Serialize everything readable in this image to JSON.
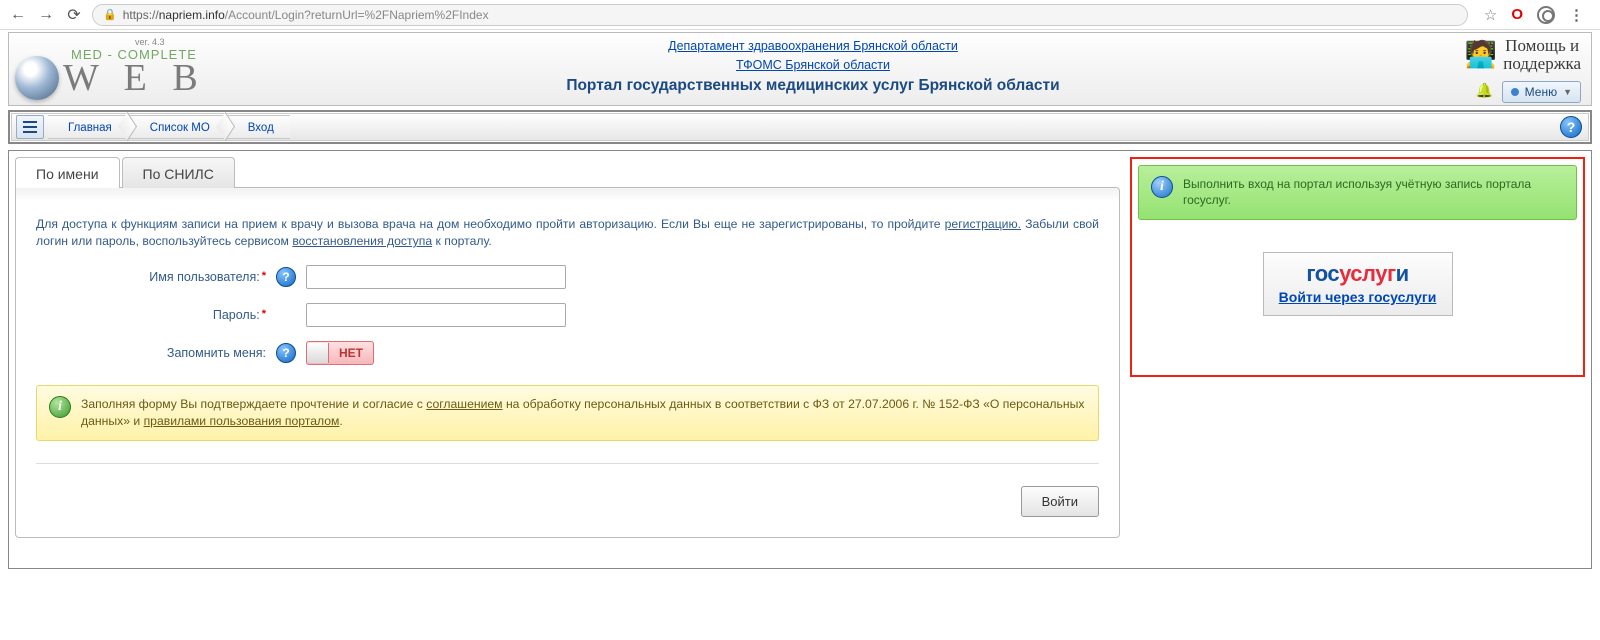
{
  "browser": {
    "url_prefix": "https://",
    "domain": "napriem.info",
    "path": "/Account/Login?returnUrl=%2FNapriem%2FIndex"
  },
  "header": {
    "version": "ver. 4.3",
    "brand_top": "MED - COMPLETE",
    "brand_bottom": "W E B",
    "dept_link": "Департамент здравоохранения Брянской области",
    "tfoms_link": "ТФОМС Брянской области",
    "title": "Портал государственных медицинских услуг Брянской области",
    "support_line1": "Помощь и",
    "support_line2": "поддержка",
    "menu_label": "Меню"
  },
  "breadcrumb": {
    "home": "Главная",
    "list": "Список МО",
    "login": "Вход"
  },
  "tabs": {
    "by_name": "По имени",
    "by_snils": "По СНИЛС"
  },
  "login": {
    "intro_prefix": "Для доступа к функциям записи на прием к врачу и вызова врача на дом необходимо пройти авторизацию. Если Вы еще не зарегистрированы, то пройдите ",
    "reg_link": "регистрацию.",
    "intro_mid": " Забыли свой логин или пароль, воспользуйтесь сервисом ",
    "recover_link": "восстановления доступа",
    "intro_suffix": " к порталу.",
    "username_label": "Имя пользователя:",
    "password_label": "Пароль:",
    "remember_label": "Запомнить меня:",
    "toggle_value": "НЕТ",
    "notice_prefix": "Заполняя форму Вы подтверждаете прочтение и согласие с ",
    "agreement_link": "соглашением",
    "notice_mid": " на обработку персональных данных в соответствии с ФЗ от 27.07.2006 г. № 152-ФЗ «О персональных данных» и ",
    "rules_link": "правилами пользования порталом",
    "notice_suffix": ".",
    "submit": "Войти"
  },
  "gosuslugi": {
    "notice": "Выполнить вход на портал используя учётную запись портала госуслуг.",
    "logo_blue1": "гос",
    "logo_red": "услуг",
    "logo_blue2": "и",
    "link": "Войти через госуслуги"
  }
}
